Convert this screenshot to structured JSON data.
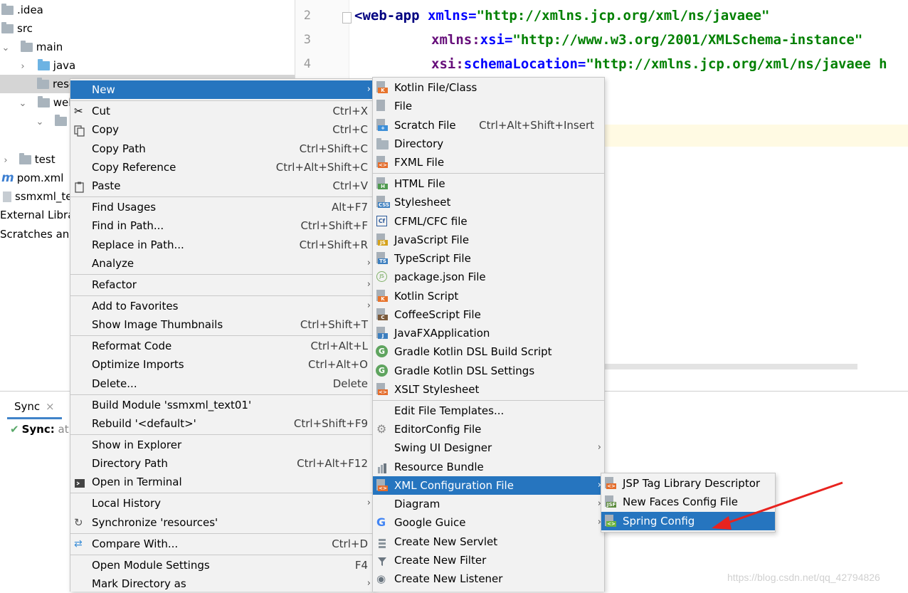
{
  "tree": {
    "items": [
      {
        "label": ".idea"
      },
      {
        "label": "src"
      },
      {
        "label": "main"
      },
      {
        "label": "java"
      },
      {
        "label": "reso"
      },
      {
        "label": "wel"
      },
      {
        "label": ""
      },
      {
        "label": "test"
      },
      {
        "label": "pom.xml"
      },
      {
        "label": "ssmxml_te"
      },
      {
        "label": "External Libra"
      },
      {
        "label": "Scratches and"
      }
    ]
  },
  "editor": {
    "line_numbers": [
      "2",
      "3",
      "4"
    ],
    "lines": [
      {
        "tag": "<web-app",
        "attr_prefix": "",
        "attr": "xmlns",
        "eq": "=",
        "value": "\"http://xmlns.jcp.org/xml/ns/javaee\""
      },
      {
        "tag": "",
        "attr_prefix": "xmlns:",
        "attr": "xsi",
        "eq": "=",
        "value": "\"http://www.w3.org/2001/XMLSchema-instance\""
      },
      {
        "tag": "",
        "attr_prefix": "xsi:",
        "attr": "schemaLocation",
        "eq": "=",
        "value": "\"http://xmlns.jcp.org/xml/ns/javaee h"
      }
    ]
  },
  "bottom": {
    "tab_label": "Sync",
    "tab_close": "×",
    "sync_status": "Sync:",
    "sync_suffix": "at"
  },
  "context_menu": {
    "new": "New",
    "cut": "Cut",
    "cut_sc": "Ctrl+X",
    "copy": "Copy",
    "copy_sc": "Ctrl+C",
    "copy_path": "Copy Path",
    "copy_path_sc": "Ctrl+Shift+C",
    "copy_reference": "Copy Reference",
    "copy_reference_sc": "Ctrl+Alt+Shift+C",
    "paste": "Paste",
    "paste_sc": "Ctrl+V",
    "find_usages": "Find Usages",
    "find_usages_sc": "Alt+F7",
    "find_in_path": "Find in Path...",
    "find_in_path_sc": "Ctrl+Shift+F",
    "replace_in_path": "Replace in Path...",
    "replace_in_path_sc": "Ctrl+Shift+R",
    "analyze": "Analyze",
    "refactor": "Refactor",
    "add_to_favorites": "Add to Favorites",
    "show_image_thumbnails": "Show Image Thumbnails",
    "show_image_thumbnails_sc": "Ctrl+Shift+T",
    "reformat_code": "Reformat Code",
    "reformat_code_sc": "Ctrl+Alt+L",
    "optimize_imports": "Optimize Imports",
    "optimize_imports_sc": "Ctrl+Alt+O",
    "delete": "Delete...",
    "delete_sc": "Delete",
    "build_module": "Build Module 'ssmxml_text01'",
    "rebuild": "Rebuild '<default>'",
    "rebuild_sc": "Ctrl+Shift+F9",
    "show_in_explorer": "Show in Explorer",
    "directory_path": "Directory Path",
    "directory_path_sc": "Ctrl+Alt+F12",
    "open_in_terminal": "Open in Terminal",
    "local_history": "Local History",
    "synchronize": "Synchronize 'resources'",
    "compare_with": "Compare With...",
    "compare_with_sc": "Ctrl+D",
    "open_module_settings": "Open Module Settings",
    "open_module_settings_sc": "F4",
    "mark_directory_as": "Mark Directory as"
  },
  "new_menu": {
    "kotlin_file": "Kotlin File/Class",
    "file": "File",
    "scratch_file": "Scratch File",
    "scratch_file_sc": "Ctrl+Alt+Shift+Insert",
    "directory": "Directory",
    "fxml_file": "FXML File",
    "html_file": "HTML File",
    "stylesheet": "Stylesheet",
    "cfml": "CFML/CFC file",
    "javascript": "JavaScript File",
    "typescript": "TypeScript File",
    "package_json": "package.json File",
    "kotlin_script": "Kotlin Script",
    "coffeescript": "CoffeeScript File",
    "javafx": "JavaFXApplication",
    "gradle_build": "Gradle Kotlin DSL Build Script",
    "gradle_settings": "Gradle Kotlin DSL Settings",
    "xslt": "XSLT Stylesheet",
    "edit_templates": "Edit File Templates...",
    "editorconfig": "EditorConfig File",
    "swing_ui": "Swing UI Designer",
    "resource_bundle": "Resource Bundle",
    "xml_config": "XML Configuration File",
    "diagram": "Diagram",
    "google_guice": "Google Guice",
    "servlet": "Create New Servlet",
    "filter": "Create New Filter",
    "listener": "Create New Listener"
  },
  "xml_menu": {
    "jsp_tld": "JSP Tag Library Descriptor",
    "faces_config": "New Faces Config File",
    "spring_config": "Spring Config"
  },
  "watermark": "https://blog.csdn.net/qq_42794826",
  "colors": {
    "highlight": "#2675bf",
    "annotation_arrow": "#e8231f",
    "menu_bg": "#f2f2f2"
  }
}
